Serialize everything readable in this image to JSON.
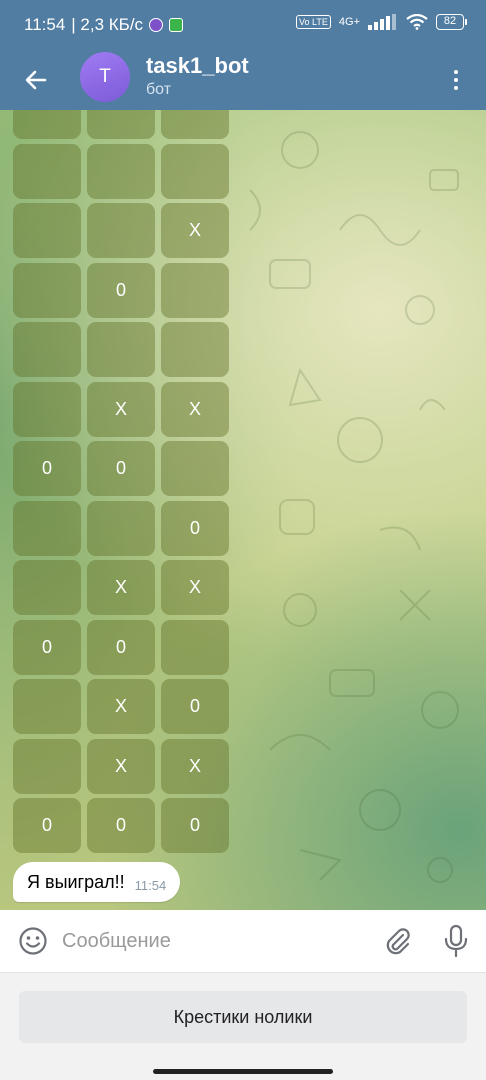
{
  "status_bar": {
    "time": "11:54",
    "speed": "| 2,3 КБ/с",
    "network": "4G+",
    "volte": "Vo LTE",
    "battery": "82"
  },
  "header": {
    "avatar_letter": "T",
    "title": "task1_bot",
    "subtitle": "бот"
  },
  "keyboard": {
    "rows": [
      [
        "",
        "",
        ""
      ],
      [
        "",
        "",
        ""
      ],
      [
        "",
        "",
        "X"
      ],
      [
        "",
        "0",
        ""
      ],
      [
        "",
        "",
        ""
      ],
      [
        "",
        "X",
        "X"
      ],
      [
        "0",
        "0",
        ""
      ],
      [
        "",
        "",
        "0"
      ],
      [
        "",
        "X",
        "X"
      ],
      [
        "0",
        "0",
        ""
      ],
      [
        "",
        "X",
        "0"
      ],
      [
        "",
        "X",
        "X"
      ],
      [
        "0",
        "0",
        "0"
      ]
    ]
  },
  "message": {
    "text": "Я выиграл!!",
    "time": "11:54"
  },
  "input": {
    "placeholder": "Сообщение"
  },
  "reply_keyboard": {
    "button_label": "Крестики нолики"
  },
  "colors": {
    "header": "#517da2",
    "button_tint": "#5f6e23"
  }
}
